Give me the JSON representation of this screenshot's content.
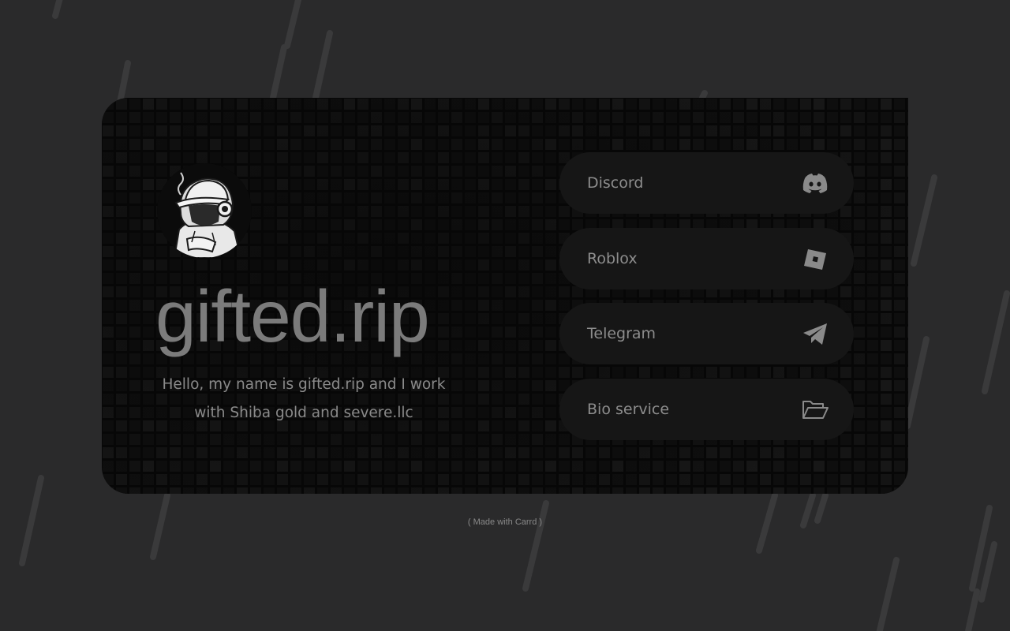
{
  "profile": {
    "title": "gifted.rip",
    "bio": "Hello, my name is gifted.rip and I work with Shiba gold and severe.llc",
    "avatar_icon": "hooded-character-avatar"
  },
  "links": [
    {
      "label": "Discord",
      "icon": "discord-icon"
    },
    {
      "label": "Roblox",
      "icon": "roblox-icon"
    },
    {
      "label": "Telegram",
      "icon": "telegram-icon"
    },
    {
      "label": "Bio service",
      "icon": "folder-open-icon"
    }
  ],
  "footer": {
    "text": "( Made with Carrd )"
  },
  "colors": {
    "page_background": "#2a2a2b",
    "card_background": "#070707",
    "button_background": "#161616",
    "text": "#8d8d8d",
    "title": "#7b7b7b"
  }
}
